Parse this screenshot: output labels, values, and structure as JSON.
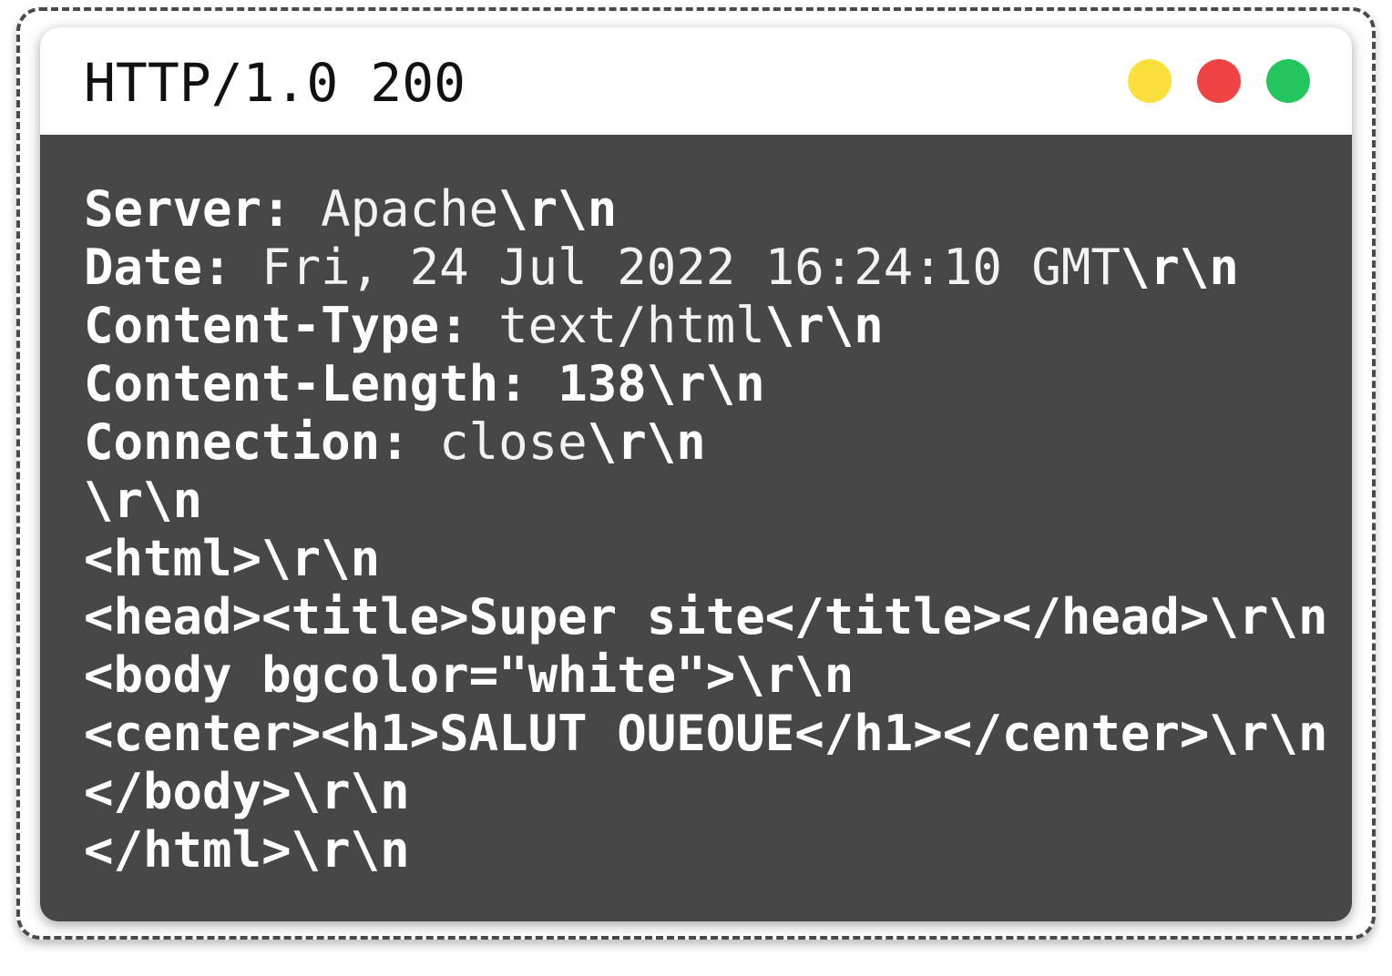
{
  "window": {
    "title": "HTTP/1.0 200",
    "dots": [
      {
        "name": "yellow-dot",
        "color": "#fbe03d"
      },
      {
        "name": "red-dot",
        "color": "#ef4344"
      },
      {
        "name": "green-dot",
        "color": "#22c55e"
      }
    ]
  },
  "response": {
    "headers": [
      {
        "key": "Server:",
        "value": "Apache",
        "value_bold": false,
        "eol": "\\r\\n"
      },
      {
        "key": "Date:",
        "value": "Fri, 24 Jul 2022 16:24:10 GMT",
        "value_bold": false,
        "eol": "\\r\\n"
      },
      {
        "key": "Content-Type:",
        "value": "text/html",
        "value_bold": false,
        "eol": "\\r\\n"
      },
      {
        "key": "Content-Length:",
        "value": "138",
        "value_bold": true,
        "eol": "\\r\\n"
      },
      {
        "key": "Connection:",
        "value": "close",
        "value_bold": false,
        "eol": "\\r\\n"
      }
    ],
    "blank_line": "\\r\\n",
    "body_lines": [
      "<html>\\r\\n",
      "<head><title>Super site</title></head>\\r\\n",
      "<body bgcolor=\"white\">\\r\\n",
      "<center><h1>SALUT OUEOUE</h1></center>\\r\\n",
      "</body>\\r\\n",
      "</html>\\r\\n"
    ]
  }
}
